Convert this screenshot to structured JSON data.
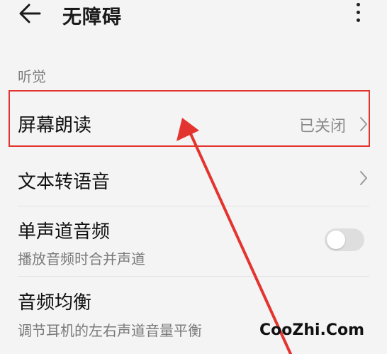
{
  "header": {
    "title": "无障碍",
    "back_icon": "arrow-left-icon",
    "more_icon": "more-vertical-icon"
  },
  "section": {
    "title": "听觉"
  },
  "rows": [
    {
      "label": "屏幕朗读",
      "value": "已关闭",
      "icon": "chevron-right-icon"
    },
    {
      "label": "文本转语音",
      "icon": "chevron-right-icon"
    },
    {
      "label": "单声道音频",
      "subtitle": "播放音频时合并声道",
      "toggle": "off"
    },
    {
      "label": "音频均衡",
      "subtitle": "调节耳机的左右声道音量平衡"
    }
  ],
  "annotation": {
    "highlight_color": "#e3342f",
    "arrow_color": "#e3342f"
  },
  "watermark": "CooZhi.Com"
}
